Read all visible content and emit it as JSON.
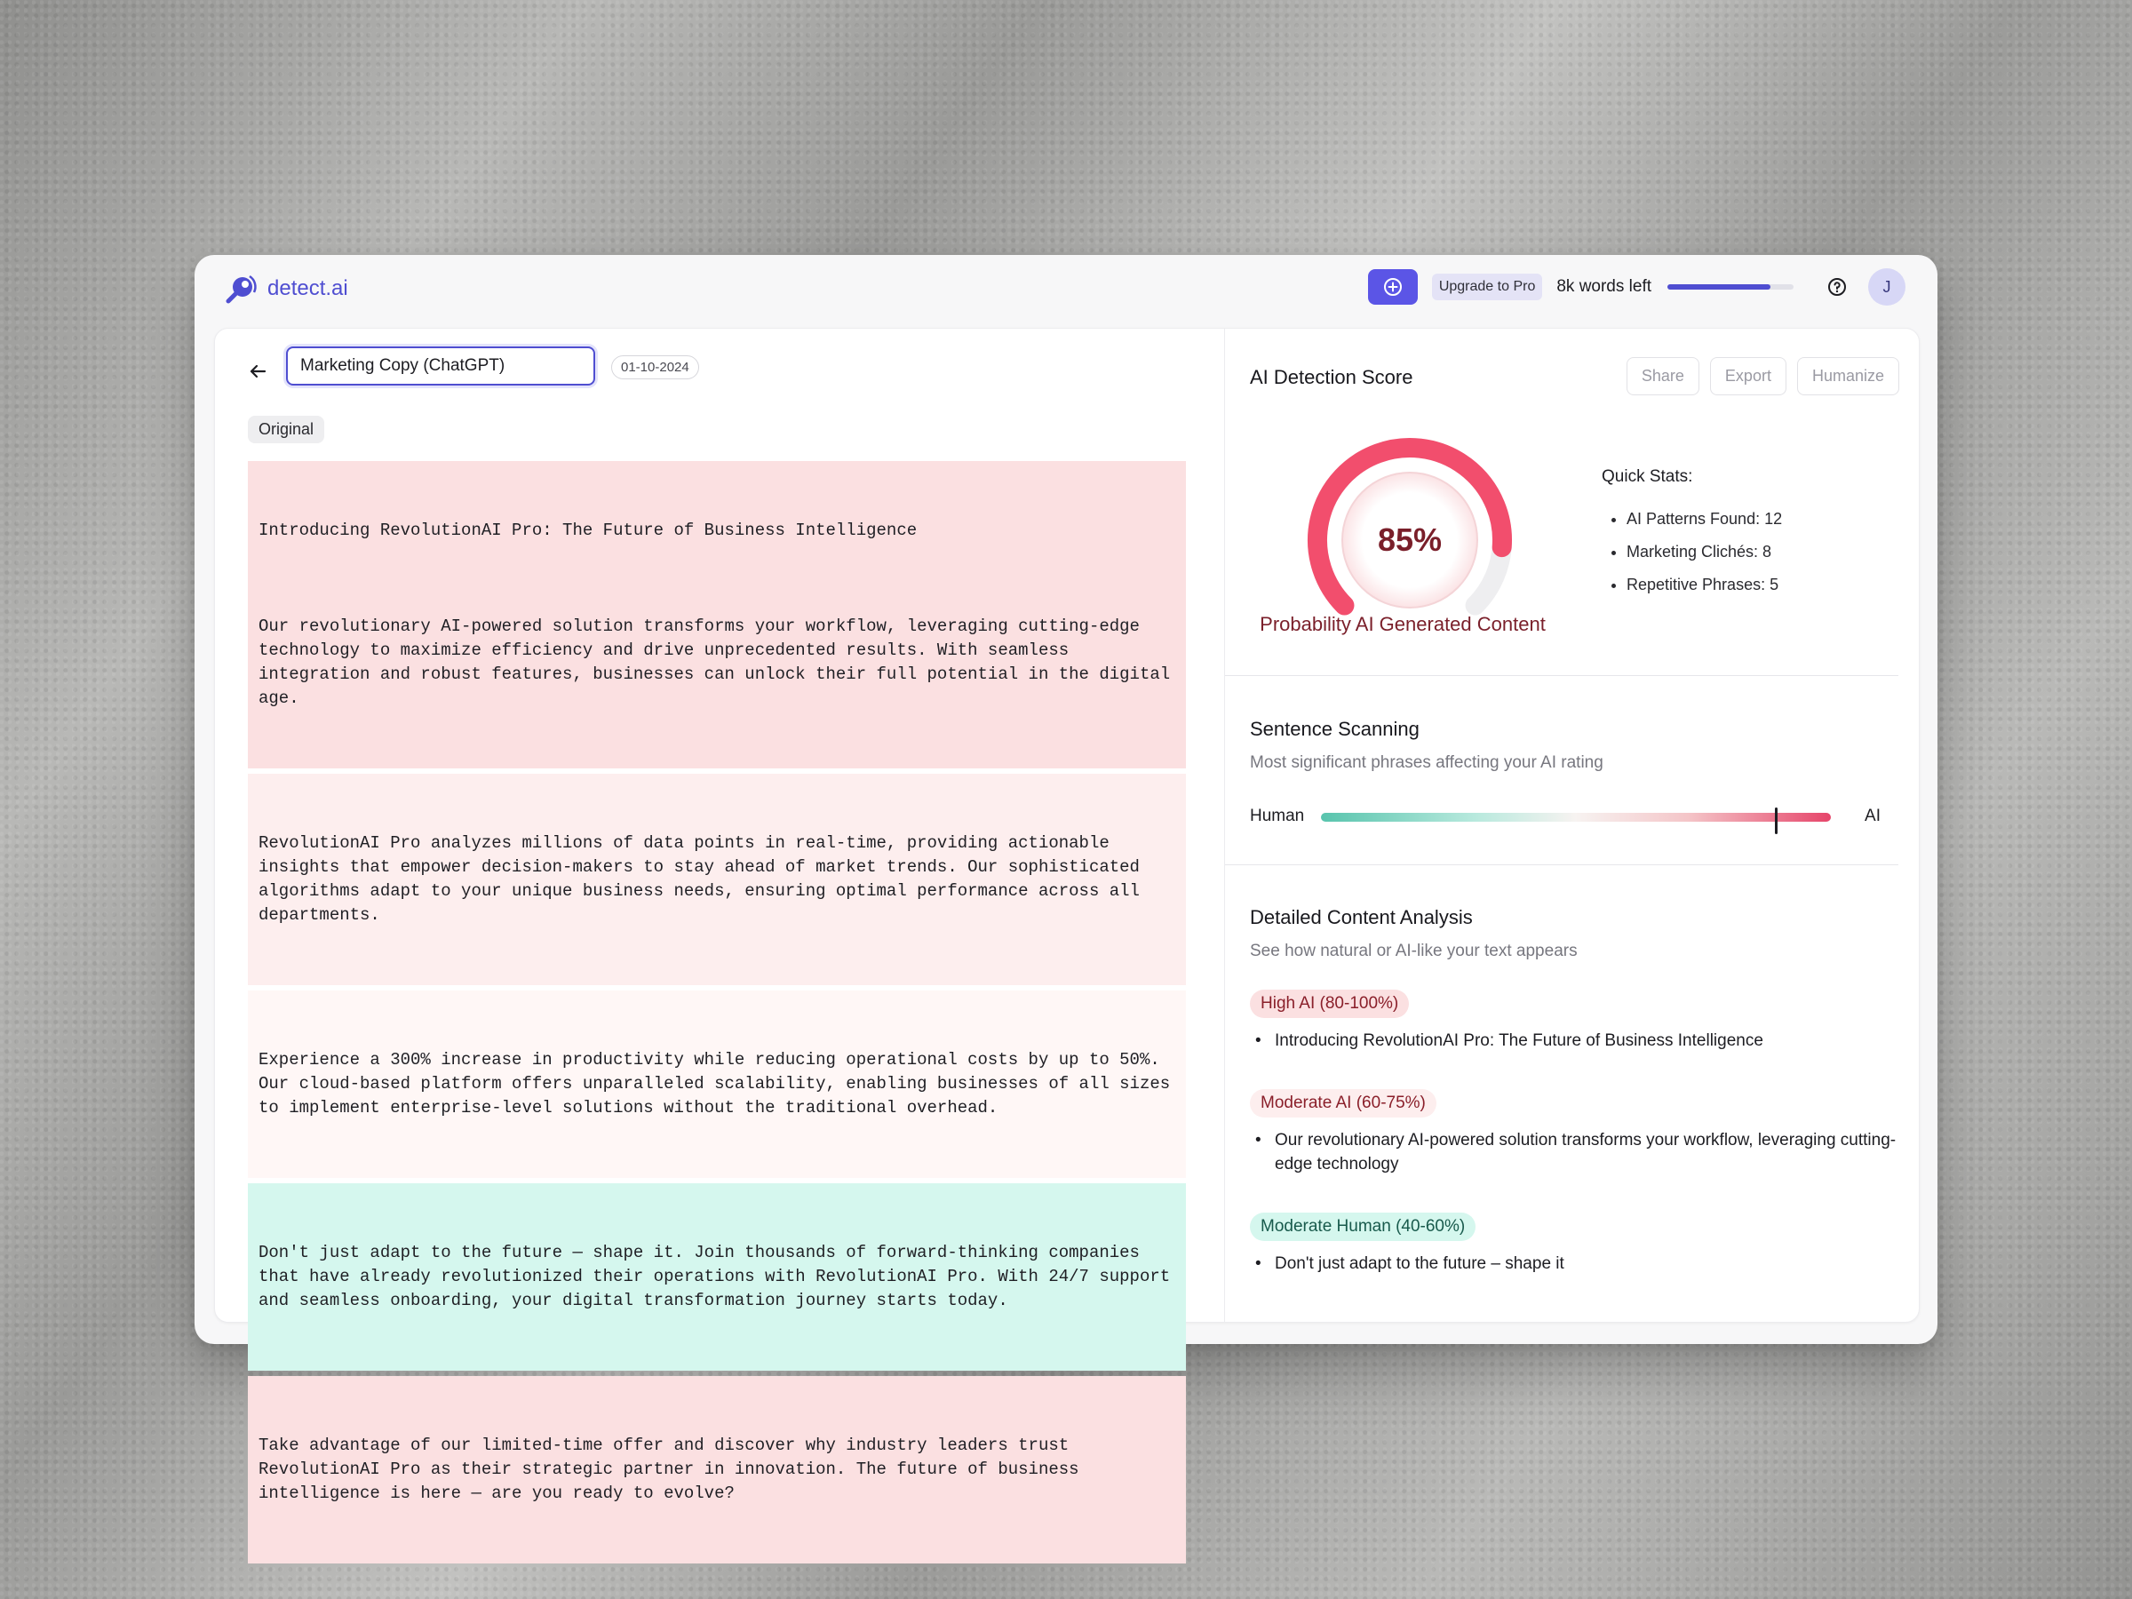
{
  "app": {
    "logo_text": "detect.ai",
    "upgrade_label": "Upgrade to Pro",
    "words_left": "8k words left",
    "words_progress_fraction": 0.82,
    "avatar_initial": "J",
    "accent_color": "#4f4ed1"
  },
  "document": {
    "title_value": "Marketing Copy (ChatGPT)",
    "date": "01-10-2024",
    "view_tab": "Original",
    "paragraphs": [
      {
        "lines": [
          "Introducing RevolutionAI Pro: The Future of Business Intelligence",
          "Our revolutionary AI-powered solution transforms your workflow, leveraging cutting-edge technology to maximize efficiency and drive unprecedented results. With seamless integration and robust features, businesses can unlock their full potential in the digital age."
        ],
        "level": "high-ai"
      },
      {
        "lines": [
          "RevolutionAI Pro analyzes millions of data points in real-time, providing actionable insights that empower decision-makers to stay ahead of market trends. Our sophisticated algorithms adapt to your unique business needs, ensuring optimal performance across all departments."
        ],
        "level": "moderate-ai"
      },
      {
        "lines": [
          "Experience a 300% increase in productivity while reducing operational costs by up to 50%. Our cloud-based platform offers unparalleled scalability, enabling businesses of all sizes to implement enterprise-level solutions without the traditional overhead."
        ],
        "level": "low-ai"
      },
      {
        "lines": [
          "Don't just adapt to the future — shape it. Join thousands of forward-thinking companies that have already revolutionized their operations with RevolutionAI Pro. With 24/7 support and seamless onboarding, your digital transformation journey starts today."
        ],
        "level": "moderate-human"
      },
      {
        "lines": [
          "Take advantage of our limited-time offer and discover why industry leaders trust RevolutionAI Pro as their strategic partner in innovation. The future of business intelligence is here — are you ready to evolve?"
        ],
        "level": "high-ai"
      }
    ]
  },
  "score": {
    "title": "AI Detection Score",
    "actions": [
      "Share",
      "Export",
      "Humanize"
    ],
    "value": "85%",
    "fraction": 0.85,
    "label": "Probability AI Generated Content",
    "stats_title": "Quick Stats:",
    "stats": [
      "AI Patterns Found: 12",
      "Marketing Clichés: 8",
      "Repetitive Phrases: 5"
    ]
  },
  "scanning": {
    "title": "Sentence Scanning",
    "subtitle": "Most significant phrases affecting your AI rating",
    "left_label": "Human",
    "right_label": "AI",
    "marker_fraction": 0.89
  },
  "analysis": {
    "title": "Detailed Content Analysis",
    "subtitle": "See how natural or AI-like your text appears",
    "groups": [
      {
        "badge": "High AI (80-100%)",
        "item": "Introducing RevolutionAI Pro: The Future of Business Intelligence"
      },
      {
        "badge": "Moderate AI (60-75%)",
        "item": "Our revolutionary AI-powered solution transforms your workflow, leveraging cutting-edge technology"
      },
      {
        "badge": "Moderate Human (40-60%)",
        "item": "Don't just adapt to the future – shape it"
      }
    ]
  },
  "icons": [
    "logo-icon",
    "add-circle-icon",
    "help-icon",
    "arrow-left-icon"
  ]
}
